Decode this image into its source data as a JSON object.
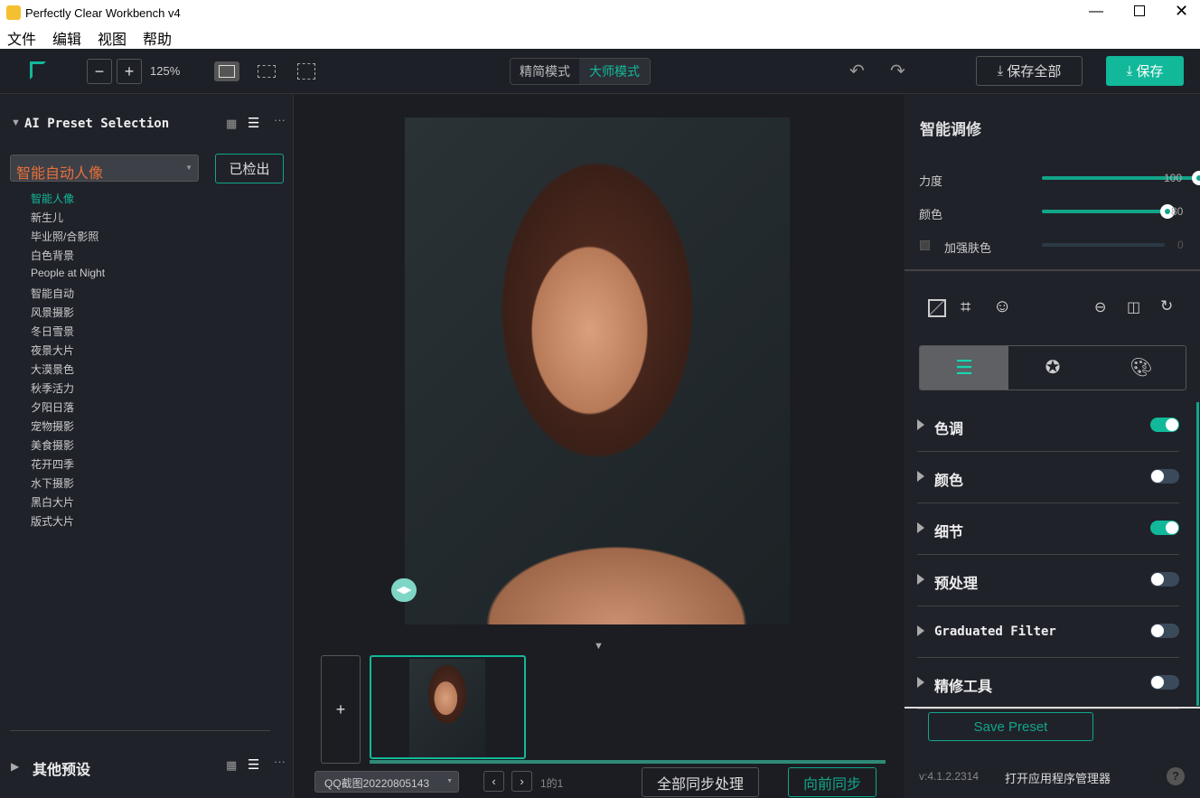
{
  "window": {
    "title": "Perfectly Clear Workbench v4"
  },
  "menu": [
    "文件",
    "编辑",
    "视图",
    "帮助"
  ],
  "toolbar": {
    "zoom": "125%",
    "mode_simple": "精简模式",
    "mode_master": "大师模式",
    "save_all": "保存全部",
    "save": "保存"
  },
  "left": {
    "title": "AI Preset Selection",
    "preset_select": "智能自动人像",
    "checked_out": "已检出",
    "presets": [
      "智能人像",
      "新生儿",
      "毕业照/合影照",
      "白色背景",
      "People at Night",
      "智能自动",
      "风景摄影",
      "冬日雪景",
      "夜景大片",
      "大漠景色",
      "秋季活力",
      "夕阳日落",
      "宠物摄影",
      "美食摄影",
      "花开四季",
      "水下摄影",
      "黑白大片",
      "版式大片"
    ],
    "other_presets": "其他预设"
  },
  "center": {
    "add": "+",
    "file_select": "QQ截图20220805143",
    "page": "1的1",
    "sync_all": "全部同步处理",
    "sync_forward": "向前同步"
  },
  "right": {
    "title": "智能调修",
    "sliders": [
      {
        "label": "力度",
        "value": 100
      },
      {
        "label": "颜色",
        "value": 80
      },
      {
        "label": "加强肤色",
        "value": 0,
        "checkbox": false
      }
    ],
    "sections": [
      {
        "label": "色调",
        "on": true
      },
      {
        "label": "颜色",
        "on": false
      },
      {
        "label": "细节",
        "on": true
      },
      {
        "label": "预处理",
        "on": false
      },
      {
        "label": "Graduated Filter",
        "on": false
      },
      {
        "label": "精修工具",
        "on": false
      }
    ],
    "save_preset": "Save Preset",
    "version": "v:4.1.2.2314",
    "app_manager": "打开应用程序管理器",
    "help": "?"
  },
  "colors": {
    "accent": "#12b89a",
    "orange": "#e8703a"
  }
}
